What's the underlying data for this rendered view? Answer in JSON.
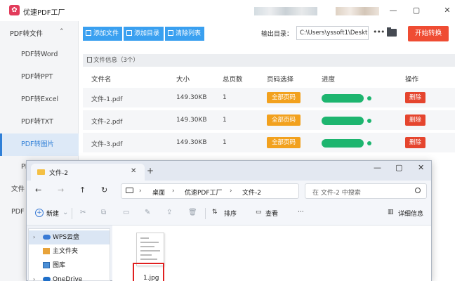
{
  "app": {
    "logo_glyph": "✿",
    "title": "优速PDF工厂",
    "controls": {
      "minimize": "—",
      "maximize": "▢",
      "close": "✕"
    }
  },
  "sidebar": {
    "group_label": "PDF转文件",
    "items": [
      {
        "label": "PDF转Word",
        "active": false
      },
      {
        "label": "PDF转PPT",
        "active": false
      },
      {
        "label": "PDF转Excel",
        "active": false
      },
      {
        "label": "PDF转TXT",
        "active": false
      },
      {
        "label": "PDF转图片",
        "active": true
      },
      {
        "label": "PDF",
        "active": false
      }
    ],
    "partial_items": [
      "文件",
      "PDF"
    ]
  },
  "toolbar": {
    "add_file": "添加文件",
    "add_folder": "添加目录",
    "clear_list": "清除列表",
    "output_label": "输出目录：",
    "output_path": "C:\\Users\\yssoft1\\Deskt",
    "start": "开始转换"
  },
  "file_info": "文件信息（3个）",
  "table": {
    "headers": [
      "文件名",
      "大小",
      "总页数",
      "页码选择",
      "进度",
      "操作"
    ],
    "rows": [
      {
        "name": "文件-1.pdf",
        "size": "149.30KB",
        "pages": "1",
        "page_select": "全部页码",
        "progress": 1.0,
        "action": "删除"
      },
      {
        "name": "文件-2.pdf",
        "size": "149.30KB",
        "pages": "1",
        "page_select": "全部页码",
        "progress": 1.0,
        "action": "删除"
      },
      {
        "name": "文件-3.pdf",
        "size": "149.30KB",
        "pages": "1",
        "page_select": "全部页码",
        "progress": 1.0,
        "action": "删除"
      }
    ]
  },
  "explorer": {
    "tab_title": "文件-2",
    "tab_close": "✕",
    "new_tab": "+",
    "window_controls": {
      "minimize": "—",
      "maximize": "▢",
      "close": "✕"
    },
    "nav": {
      "back": "←",
      "forward": "→",
      "up": "↑",
      "refresh": "↻"
    },
    "breadcrumb": [
      "桌面",
      "优速PDF工厂",
      "文件-2"
    ],
    "breadcrumb_sep": "›",
    "search_placeholder": "在 文件-2 中搜索",
    "commands": {
      "new": "新建",
      "sort": "排序",
      "view": "查看",
      "more": "···",
      "details": "详细信息"
    },
    "nav_pane": [
      {
        "label": "WPS云盘",
        "icon": "cloud-icon",
        "selected": true
      },
      {
        "label": "主文件夹",
        "icon": "home-icon",
        "selected": false
      },
      {
        "label": "图库",
        "icon": "gallery-icon",
        "selected": false
      },
      {
        "label": "OneDrive",
        "icon": "onedrive-icon",
        "selected": false
      }
    ],
    "files": [
      {
        "name": "1.jpg",
        "selected": true
      }
    ]
  },
  "colors": {
    "accent_blue": "#3aa0f0",
    "start_red": "#ef4c33",
    "page_orange": "#f2a11e",
    "progress_green": "#1db56f",
    "delete_red": "#e5452e",
    "sidebar_active": "#2f7fd7"
  }
}
